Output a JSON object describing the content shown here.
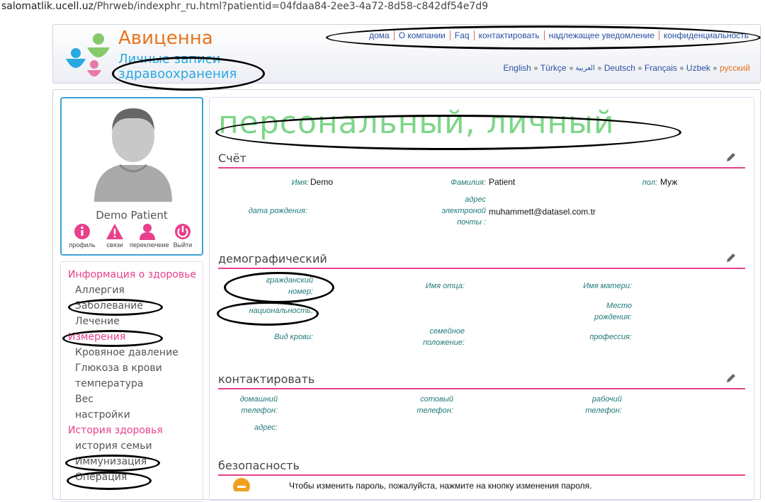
{
  "url": {
    "host": "salomatlik.ucell.uz",
    "path": "/Phrweb/indexphr_ru.html?patientid=04fdaa84-2ee3-4a72-8d58-c842df54e7d9"
  },
  "brand": {
    "name": "Авиценна",
    "subtitle_line1": "Личные записи",
    "subtitle_line2": "здравоохранения"
  },
  "topnav": [
    "дома",
    "О компании",
    "Faq",
    "контактировать",
    "надлежащее уведомление",
    "конфиденциальность"
  ],
  "languages": [
    {
      "label": "English"
    },
    {
      "label": "Türkçe"
    },
    {
      "label": "العربية"
    },
    {
      "label": "Deutsch"
    },
    {
      "label": "Français"
    },
    {
      "label": "Uzbek"
    },
    {
      "label": "русский",
      "active": true
    }
  ],
  "profile": {
    "name": "Demo Patient",
    "actions": [
      {
        "label": "профиль",
        "icon": "info-icon"
      },
      {
        "label": "связи",
        "icon": "warning-icon"
      },
      {
        "label": "переключеие",
        "icon": "user-icon"
      },
      {
        "label": "Выйти",
        "icon": "power-icon"
      }
    ]
  },
  "sidebar": {
    "health_info": "Информация о здоровье",
    "items1": [
      "Аллергия",
      "Заболевание",
      "Лечение"
    ],
    "measurements": "Измерения",
    "items2": [
      "Кровяное давление",
      "Глюкоза в крови",
      "температура",
      "Вес",
      "настройки"
    ],
    "health_history": "История здоровья",
    "items3": [
      "история семьи",
      "Иммунизация",
      "Операция"
    ]
  },
  "page_title": "персональный, личный",
  "account": {
    "title": "Счёт",
    "first_name_label": "Имя:",
    "first_name": "Demo",
    "last_name_label": "Фамилия:",
    "last_name": "Patient",
    "gender_label": "пол:",
    "gender": "Муж",
    "birth_label": "дата рождения:",
    "email_label1": "адрес",
    "email_label2": "электроной",
    "email_label3": "почты :",
    "email": "muhammett@datasel.com.tr"
  },
  "demographic": {
    "title": "демографический",
    "citizen1": "гражданский",
    "citizen2": "номер:",
    "father": "Имя отца:",
    "mother": "Имя матери:",
    "nationality": "национальность:",
    "birthplace1": "Место",
    "birthplace2": "рождения:",
    "blood": "Вид крови:",
    "marital1": "семейное",
    "marital2": "положение:",
    "profession": "профессия:"
  },
  "contact": {
    "title": "контактировать",
    "home1": "домашний",
    "home2": "телефон:",
    "mobile1": "сотовый",
    "mobile2": "телефон:",
    "work1": "рабочий",
    "work2": "телефон:",
    "address": "адрес:"
  },
  "security": {
    "title": "безопасность",
    "text": "Чтобы изменить пароль, пожалуйста, нажмите на кнопку изменения пароля."
  }
}
